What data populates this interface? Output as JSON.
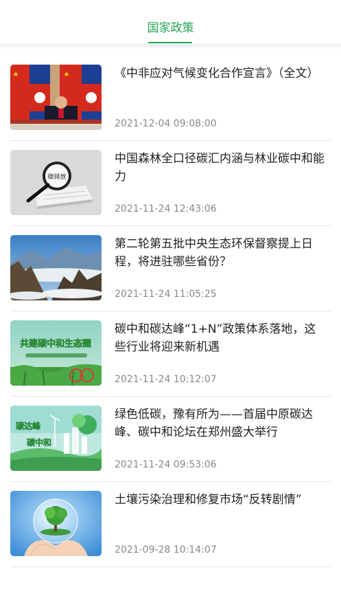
{
  "header": {
    "tab_title": "国家政策",
    "accent_color": "#27a555"
  },
  "articles": [
    {
      "title": "《中非应对气候变化合作宣言》（全文）",
      "time": "2021-12-04 09:08:00",
      "thumb": "video-conference-flags"
    },
    {
      "title": "中国森林全口径碳汇内涵与林业碳中和能力",
      "time": "2021-11-24 12:43:06",
      "thumb": "magnifier-carbon-emission"
    },
    {
      "title": "第二轮第五批中央生态环保督察提上日程，将进驻哪些省份？",
      "time": "2021-11-24 11:05:25",
      "thumb": "mountain-landscape"
    },
    {
      "title": "碳中和碳达峰“1+N”政策体系落地，这些行业将迎来新机遇",
      "time": "2021-11-24 10:12:07",
      "thumb": "carbon-neutral-poster",
      "thumb_text": "共建碳中和生态圈"
    },
    {
      "title": "绿色低碳，豫有所为——首届中原碳达峰、碳中和论坛在郑州盛大举行",
      "time": "2021-11-24 09:53:06",
      "thumb": "green-city-illustration",
      "thumb_text_1": "碳达峰",
      "thumb_text_2": "碳中和"
    },
    {
      "title": "土壤污染治理和修复市场“反转剧情”",
      "time": "2021-09-28 10:14:07",
      "thumb": "tree-in-globe-hands"
    }
  ]
}
